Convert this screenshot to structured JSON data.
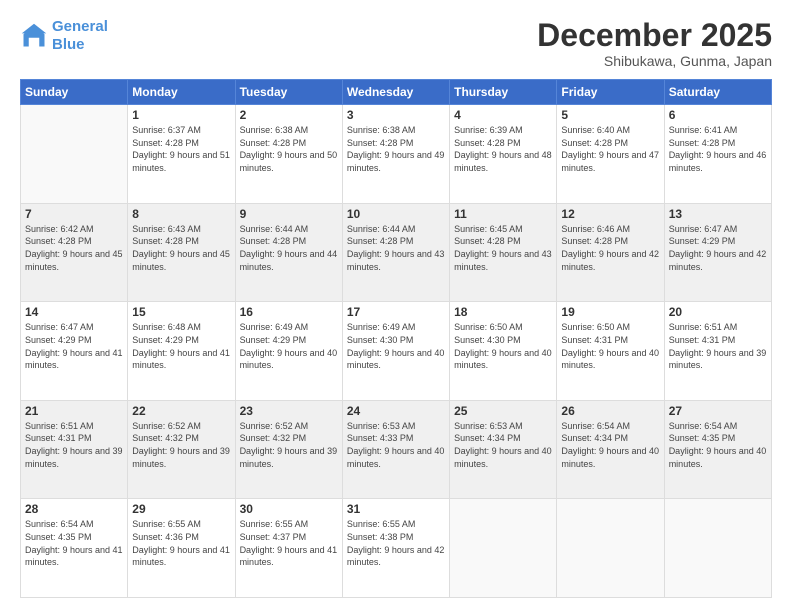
{
  "logo": {
    "line1": "General",
    "line2": "Blue"
  },
  "title": "December 2025",
  "location": "Shibukawa, Gunma, Japan",
  "weekdays": [
    "Sunday",
    "Monday",
    "Tuesday",
    "Wednesday",
    "Thursday",
    "Friday",
    "Saturday"
  ],
  "weeks": [
    [
      {
        "day": "",
        "sunrise": "",
        "sunset": "",
        "daylight": ""
      },
      {
        "day": "1",
        "sunrise": "Sunrise: 6:37 AM",
        "sunset": "Sunset: 4:28 PM",
        "daylight": "Daylight: 9 hours and 51 minutes."
      },
      {
        "day": "2",
        "sunrise": "Sunrise: 6:38 AM",
        "sunset": "Sunset: 4:28 PM",
        "daylight": "Daylight: 9 hours and 50 minutes."
      },
      {
        "day": "3",
        "sunrise": "Sunrise: 6:38 AM",
        "sunset": "Sunset: 4:28 PM",
        "daylight": "Daylight: 9 hours and 49 minutes."
      },
      {
        "day": "4",
        "sunrise": "Sunrise: 6:39 AM",
        "sunset": "Sunset: 4:28 PM",
        "daylight": "Daylight: 9 hours and 48 minutes."
      },
      {
        "day": "5",
        "sunrise": "Sunrise: 6:40 AM",
        "sunset": "Sunset: 4:28 PM",
        "daylight": "Daylight: 9 hours and 47 minutes."
      },
      {
        "day": "6",
        "sunrise": "Sunrise: 6:41 AM",
        "sunset": "Sunset: 4:28 PM",
        "daylight": "Daylight: 9 hours and 46 minutes."
      }
    ],
    [
      {
        "day": "7",
        "sunrise": "Sunrise: 6:42 AM",
        "sunset": "Sunset: 4:28 PM",
        "daylight": "Daylight: 9 hours and 45 minutes."
      },
      {
        "day": "8",
        "sunrise": "Sunrise: 6:43 AM",
        "sunset": "Sunset: 4:28 PM",
        "daylight": "Daylight: 9 hours and 45 minutes."
      },
      {
        "day": "9",
        "sunrise": "Sunrise: 6:44 AM",
        "sunset": "Sunset: 4:28 PM",
        "daylight": "Daylight: 9 hours and 44 minutes."
      },
      {
        "day": "10",
        "sunrise": "Sunrise: 6:44 AM",
        "sunset": "Sunset: 4:28 PM",
        "daylight": "Daylight: 9 hours and 43 minutes."
      },
      {
        "day": "11",
        "sunrise": "Sunrise: 6:45 AM",
        "sunset": "Sunset: 4:28 PM",
        "daylight": "Daylight: 9 hours and 43 minutes."
      },
      {
        "day": "12",
        "sunrise": "Sunrise: 6:46 AM",
        "sunset": "Sunset: 4:28 PM",
        "daylight": "Daylight: 9 hours and 42 minutes."
      },
      {
        "day": "13",
        "sunrise": "Sunrise: 6:47 AM",
        "sunset": "Sunset: 4:29 PM",
        "daylight": "Daylight: 9 hours and 42 minutes."
      }
    ],
    [
      {
        "day": "14",
        "sunrise": "Sunrise: 6:47 AM",
        "sunset": "Sunset: 4:29 PM",
        "daylight": "Daylight: 9 hours and 41 minutes."
      },
      {
        "day": "15",
        "sunrise": "Sunrise: 6:48 AM",
        "sunset": "Sunset: 4:29 PM",
        "daylight": "Daylight: 9 hours and 41 minutes."
      },
      {
        "day": "16",
        "sunrise": "Sunrise: 6:49 AM",
        "sunset": "Sunset: 4:29 PM",
        "daylight": "Daylight: 9 hours and 40 minutes."
      },
      {
        "day": "17",
        "sunrise": "Sunrise: 6:49 AM",
        "sunset": "Sunset: 4:30 PM",
        "daylight": "Daylight: 9 hours and 40 minutes."
      },
      {
        "day": "18",
        "sunrise": "Sunrise: 6:50 AM",
        "sunset": "Sunset: 4:30 PM",
        "daylight": "Daylight: 9 hours and 40 minutes."
      },
      {
        "day": "19",
        "sunrise": "Sunrise: 6:50 AM",
        "sunset": "Sunset: 4:31 PM",
        "daylight": "Daylight: 9 hours and 40 minutes."
      },
      {
        "day": "20",
        "sunrise": "Sunrise: 6:51 AM",
        "sunset": "Sunset: 4:31 PM",
        "daylight": "Daylight: 9 hours and 39 minutes."
      }
    ],
    [
      {
        "day": "21",
        "sunrise": "Sunrise: 6:51 AM",
        "sunset": "Sunset: 4:31 PM",
        "daylight": "Daylight: 9 hours and 39 minutes."
      },
      {
        "day": "22",
        "sunrise": "Sunrise: 6:52 AM",
        "sunset": "Sunset: 4:32 PM",
        "daylight": "Daylight: 9 hours and 39 minutes."
      },
      {
        "day": "23",
        "sunrise": "Sunrise: 6:52 AM",
        "sunset": "Sunset: 4:32 PM",
        "daylight": "Daylight: 9 hours and 39 minutes."
      },
      {
        "day": "24",
        "sunrise": "Sunrise: 6:53 AM",
        "sunset": "Sunset: 4:33 PM",
        "daylight": "Daylight: 9 hours and 40 minutes."
      },
      {
        "day": "25",
        "sunrise": "Sunrise: 6:53 AM",
        "sunset": "Sunset: 4:34 PM",
        "daylight": "Daylight: 9 hours and 40 minutes."
      },
      {
        "day": "26",
        "sunrise": "Sunrise: 6:54 AM",
        "sunset": "Sunset: 4:34 PM",
        "daylight": "Daylight: 9 hours and 40 minutes."
      },
      {
        "day": "27",
        "sunrise": "Sunrise: 6:54 AM",
        "sunset": "Sunset: 4:35 PM",
        "daylight": "Daylight: 9 hours and 40 minutes."
      }
    ],
    [
      {
        "day": "28",
        "sunrise": "Sunrise: 6:54 AM",
        "sunset": "Sunset: 4:35 PM",
        "daylight": "Daylight: 9 hours and 41 minutes."
      },
      {
        "day": "29",
        "sunrise": "Sunrise: 6:55 AM",
        "sunset": "Sunset: 4:36 PM",
        "daylight": "Daylight: 9 hours and 41 minutes."
      },
      {
        "day": "30",
        "sunrise": "Sunrise: 6:55 AM",
        "sunset": "Sunset: 4:37 PM",
        "daylight": "Daylight: 9 hours and 41 minutes."
      },
      {
        "day": "31",
        "sunrise": "Sunrise: 6:55 AM",
        "sunset": "Sunset: 4:38 PM",
        "daylight": "Daylight: 9 hours and 42 minutes."
      },
      {
        "day": "",
        "sunrise": "",
        "sunset": "",
        "daylight": ""
      },
      {
        "day": "",
        "sunrise": "",
        "sunset": "",
        "daylight": ""
      },
      {
        "day": "",
        "sunrise": "",
        "sunset": "",
        "daylight": ""
      }
    ]
  ]
}
